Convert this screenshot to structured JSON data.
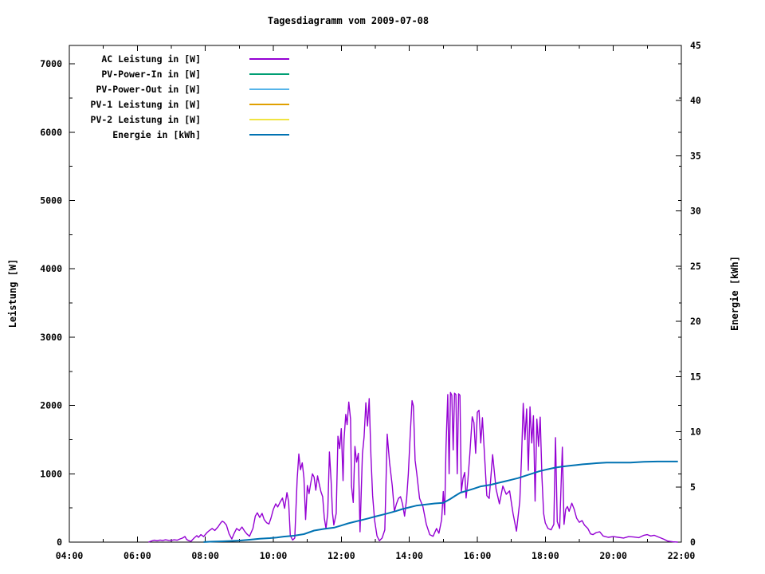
{
  "title": "Tagesdiagramm vom 2009-07-08",
  "chart_data": {
    "type": "line",
    "title": "Tagesdiagramm vom 2009-07-08",
    "grid": false,
    "legend_position": "top-left",
    "x_axis": {
      "range": [
        4,
        22
      ],
      "major_ticks": [
        {
          "h": 4,
          "label": "04:00"
        },
        {
          "h": 6,
          "label": "06:00"
        },
        {
          "h": 8,
          "label": "08:00"
        },
        {
          "h": 10,
          "label": "10:00"
        },
        {
          "h": 12,
          "label": "12:00"
        },
        {
          "h": 14,
          "label": "14:00"
        },
        {
          "h": 16,
          "label": "16:00"
        },
        {
          "h": 18,
          "label": "18:00"
        },
        {
          "h": 20,
          "label": "20:00"
        },
        {
          "h": 22,
          "label": "22:00"
        }
      ],
      "minor_hours": [
        5,
        7,
        9,
        11,
        13,
        15,
        17,
        19,
        21
      ]
    },
    "left_axis": {
      "label": "Leistung [W]",
      "range": [
        0,
        7270
      ],
      "ticks": [
        0,
        1000,
        2000,
        3000,
        4000,
        5000,
        6000,
        7000
      ],
      "minor_step": 500
    },
    "right_axis": {
      "label": "Energie [kWh]",
      "range": [
        0,
        45
      ],
      "ticks": [
        0,
        5,
        10,
        15,
        20,
        25,
        30,
        35,
        40,
        45
      ]
    },
    "series": [
      {
        "name": "AC Leistung in [W]",
        "color": "#9400d3",
        "axis": "left",
        "width": 1.4,
        "points": [
          [
            6.33,
            0
          ],
          [
            6.42,
            18
          ],
          [
            6.5,
            28
          ],
          [
            6.58,
            20
          ],
          [
            6.67,
            30
          ],
          [
            6.75,
            24
          ],
          [
            6.83,
            34
          ],
          [
            6.92,
            26
          ],
          [
            7.0,
            24
          ],
          [
            7.08,
            34
          ],
          [
            7.17,
            28
          ],
          [
            7.25,
            45
          ],
          [
            7.33,
            60
          ],
          [
            7.4,
            82
          ],
          [
            7.45,
            40
          ],
          [
            7.5,
            25
          ],
          [
            7.58,
            12
          ],
          [
            7.67,
            60
          ],
          [
            7.75,
            95
          ],
          [
            7.8,
            70
          ],
          [
            7.87,
            110
          ],
          [
            7.95,
            80
          ],
          [
            8.05,
            140
          ],
          [
            8.12,
            170
          ],
          [
            8.2,
            200
          ],
          [
            8.28,
            170
          ],
          [
            8.37,
            222
          ],
          [
            8.45,
            280
          ],
          [
            8.5,
            307
          ],
          [
            8.55,
            290
          ],
          [
            8.62,
            250
          ],
          [
            8.7,
            120
          ],
          [
            8.78,
            47
          ],
          [
            8.85,
            130
          ],
          [
            8.92,
            200
          ],
          [
            9.0,
            170
          ],
          [
            9.08,
            220
          ],
          [
            9.15,
            165
          ],
          [
            9.22,
            120
          ],
          [
            9.3,
            85
          ],
          [
            9.4,
            200
          ],
          [
            9.47,
            380
          ],
          [
            9.53,
            430
          ],
          [
            9.6,
            360
          ],
          [
            9.67,
            420
          ],
          [
            9.73,
            330
          ],
          [
            9.8,
            285
          ],
          [
            9.87,
            265
          ],
          [
            9.93,
            350
          ],
          [
            10.0,
            480
          ],
          [
            10.07,
            560
          ],
          [
            10.13,
            515
          ],
          [
            10.2,
            585
          ],
          [
            10.27,
            645
          ],
          [
            10.33,
            495
          ],
          [
            10.4,
            725
          ],
          [
            10.45,
            590
          ],
          [
            10.5,
            95
          ],
          [
            10.57,
            30
          ],
          [
            10.63,
            60
          ],
          [
            10.7,
            920
          ],
          [
            10.75,
            1290
          ],
          [
            10.8,
            1060
          ],
          [
            10.85,
            1160
          ],
          [
            10.9,
            940
          ],
          [
            10.95,
            330
          ],
          [
            11.0,
            830
          ],
          [
            11.05,
            710
          ],
          [
            11.1,
            860
          ],
          [
            11.15,
            1000
          ],
          [
            11.2,
            950
          ],
          [
            11.25,
            760
          ],
          [
            11.3,
            970
          ],
          [
            11.35,
            850
          ],
          [
            11.4,
            740
          ],
          [
            11.45,
            665
          ],
          [
            11.5,
            350
          ],
          [
            11.55,
            200
          ],
          [
            11.6,
            430
          ],
          [
            11.65,
            1320
          ],
          [
            11.7,
            900
          ],
          [
            11.74,
            430
          ],
          [
            11.78,
            250
          ],
          [
            11.85,
            420
          ],
          [
            11.9,
            1550
          ],
          [
            11.95,
            1370
          ],
          [
            12.0,
            1660
          ],
          [
            12.05,
            900
          ],
          [
            12.08,
            1500
          ],
          [
            12.13,
            1870
          ],
          [
            12.17,
            1720
          ],
          [
            12.22,
            2050
          ],
          [
            12.27,
            1800
          ],
          [
            12.3,
            820
          ],
          [
            12.35,
            580
          ],
          [
            12.4,
            1400
          ],
          [
            12.45,
            1170
          ],
          [
            12.5,
            1300
          ],
          [
            12.55,
            150
          ],
          [
            12.62,
            1290
          ],
          [
            12.67,
            1540
          ],
          [
            12.72,
            2040
          ],
          [
            12.77,
            1700
          ],
          [
            12.82,
            2100
          ],
          [
            12.87,
            1260
          ],
          [
            12.92,
            680
          ],
          [
            12.98,
            320
          ],
          [
            13.05,
            90
          ],
          [
            13.12,
            20
          ],
          [
            13.2,
            60
          ],
          [
            13.28,
            180
          ],
          [
            13.35,
            1580
          ],
          [
            13.42,
            1160
          ],
          [
            13.5,
            820
          ],
          [
            13.56,
            450
          ],
          [
            13.62,
            560
          ],
          [
            13.68,
            640
          ],
          [
            13.74,
            665
          ],
          [
            13.8,
            560
          ],
          [
            13.86,
            380
          ],
          [
            13.92,
            640
          ],
          [
            13.97,
            995
          ],
          [
            14.03,
            1600
          ],
          [
            14.08,
            2070
          ],
          [
            14.12,
            1990
          ],
          [
            14.17,
            1200
          ],
          [
            14.22,
            995
          ],
          [
            14.3,
            640
          ],
          [
            14.4,
            520
          ],
          [
            14.5,
            260
          ],
          [
            14.6,
            110
          ],
          [
            14.7,
            85
          ],
          [
            14.8,
            200
          ],
          [
            14.87,
            130
          ],
          [
            14.95,
            330
          ],
          [
            15.0,
            740
          ],
          [
            15.04,
            400
          ],
          [
            15.08,
            1400
          ],
          [
            15.13,
            2160
          ],
          [
            15.17,
            1000
          ],
          [
            15.21,
            2190
          ],
          [
            15.25,
            2150
          ],
          [
            15.29,
            1350
          ],
          [
            15.33,
            2180
          ],
          [
            15.37,
            2160
          ],
          [
            15.41,
            1000
          ],
          [
            15.45,
            2170
          ],
          [
            15.49,
            2150
          ],
          [
            15.53,
            740
          ],
          [
            15.58,
            935
          ],
          [
            15.63,
            1020
          ],
          [
            15.67,
            645
          ],
          [
            15.72,
            900
          ],
          [
            15.78,
            1290
          ],
          [
            15.85,
            1835
          ],
          [
            15.9,
            1750
          ],
          [
            15.95,
            1300
          ],
          [
            16.0,
            1900
          ],
          [
            16.05,
            1930
          ],
          [
            16.1,
            1450
          ],
          [
            16.15,
            1820
          ],
          [
            16.2,
            1380
          ],
          [
            16.28,
            680
          ],
          [
            16.35,
            640
          ],
          [
            16.45,
            1280
          ],
          [
            16.55,
            780
          ],
          [
            16.65,
            560
          ],
          [
            16.75,
            820
          ],
          [
            16.85,
            700
          ],
          [
            16.95,
            750
          ],
          [
            17.05,
            420
          ],
          [
            17.15,
            160
          ],
          [
            17.25,
            600
          ],
          [
            17.3,
            1250
          ],
          [
            17.35,
            2030
          ],
          [
            17.4,
            1500
          ],
          [
            17.45,
            1950
          ],
          [
            17.5,
            1050
          ],
          [
            17.55,
            1980
          ],
          [
            17.6,
            1450
          ],
          [
            17.65,
            1850
          ],
          [
            17.7,
            600
          ],
          [
            17.75,
            1800
          ],
          [
            17.8,
            1400
          ],
          [
            17.85,
            1830
          ],
          [
            17.9,
            950
          ],
          [
            17.95,
            420
          ],
          [
            18.0,
            280
          ],
          [
            18.08,
            200
          ],
          [
            18.17,
            180
          ],
          [
            18.25,
            260
          ],
          [
            18.3,
            1530
          ],
          [
            18.35,
            300
          ],
          [
            18.42,
            200
          ],
          [
            18.5,
            1390
          ],
          [
            18.55,
            260
          ],
          [
            18.6,
            480
          ],
          [
            18.65,
            520
          ],
          [
            18.7,
            450
          ],
          [
            18.78,
            570
          ],
          [
            18.85,
            480
          ],
          [
            18.92,
            350
          ],
          [
            19.0,
            290
          ],
          [
            19.08,
            315
          ],
          [
            19.15,
            250
          ],
          [
            19.25,
            200
          ],
          [
            19.33,
            120
          ],
          [
            19.4,
            110
          ],
          [
            19.5,
            140
          ],
          [
            19.6,
            150
          ],
          [
            19.7,
            90
          ],
          [
            19.85,
            70
          ],
          [
            20.0,
            80
          ],
          [
            20.15,
            70
          ],
          [
            20.3,
            60
          ],
          [
            20.45,
            80
          ],
          [
            20.6,
            75
          ],
          [
            20.75,
            65
          ],
          [
            20.9,
            100
          ],
          [
            21.0,
            110
          ],
          [
            21.1,
            90
          ],
          [
            21.2,
            100
          ],
          [
            21.35,
            70
          ],
          [
            21.5,
            40
          ],
          [
            21.6,
            15
          ],
          [
            21.75,
            5
          ],
          [
            21.9,
            0
          ]
        ]
      },
      {
        "name": "PV-Power-In in [W]",
        "color": "#009e73",
        "axis": "left",
        "width": 1.4,
        "points": []
      },
      {
        "name": "PV-Power-Out in [W]",
        "color": "#56b4e9",
        "axis": "left",
        "width": 1.4,
        "points": []
      },
      {
        "name": "PV-1 Leistung in [W]",
        "color": "#e0a000",
        "axis": "left",
        "width": 1.4,
        "points": []
      },
      {
        "name": "PV-2 Leistung in [W]",
        "color": "#f0e442",
        "axis": "left",
        "width": 1.4,
        "points": []
      },
      {
        "name": "Energie in [kWh]",
        "color": "#0072b2",
        "axis": "right",
        "width": 2,
        "points": [
          [
            7.95,
            0.01
          ],
          [
            8.2,
            0.04
          ],
          [
            8.5,
            0.07
          ],
          [
            8.8,
            0.11
          ],
          [
            9.0,
            0.14
          ],
          [
            9.3,
            0.22
          ],
          [
            9.6,
            0.3
          ],
          [
            9.9,
            0.36
          ],
          [
            10.1,
            0.42
          ],
          [
            10.3,
            0.5
          ],
          [
            10.6,
            0.58
          ],
          [
            10.9,
            0.72
          ],
          [
            11.2,
            1.05
          ],
          [
            11.5,
            1.2
          ],
          [
            11.8,
            1.32
          ],
          [
            12.0,
            1.5
          ],
          [
            12.2,
            1.7
          ],
          [
            12.4,
            1.85
          ],
          [
            12.6,
            2.0
          ],
          [
            12.8,
            2.15
          ],
          [
            13.0,
            2.32
          ],
          [
            13.3,
            2.55
          ],
          [
            13.6,
            2.8
          ],
          [
            13.8,
            3.0
          ],
          [
            14.0,
            3.15
          ],
          [
            14.2,
            3.3
          ],
          [
            14.5,
            3.42
          ],
          [
            14.75,
            3.5
          ],
          [
            15.0,
            3.56
          ],
          [
            15.2,
            3.9
          ],
          [
            15.35,
            4.2
          ],
          [
            15.5,
            4.48
          ],
          [
            15.7,
            4.65
          ],
          [
            15.9,
            4.85
          ],
          [
            16.1,
            5.05
          ],
          [
            16.4,
            5.2
          ],
          [
            16.6,
            5.35
          ],
          [
            16.8,
            5.5
          ],
          [
            17.0,
            5.65
          ],
          [
            17.2,
            5.8
          ],
          [
            17.4,
            6.0
          ],
          [
            17.6,
            6.2
          ],
          [
            17.8,
            6.4
          ],
          [
            18.0,
            6.55
          ],
          [
            18.15,
            6.65
          ],
          [
            18.3,
            6.75
          ],
          [
            18.5,
            6.85
          ],
          [
            18.7,
            6.92
          ],
          [
            18.9,
            6.98
          ],
          [
            19.1,
            7.05
          ],
          [
            19.3,
            7.1
          ],
          [
            19.5,
            7.15
          ],
          [
            19.8,
            7.2
          ],
          [
            20.5,
            7.2
          ],
          [
            20.9,
            7.28
          ],
          [
            21.3,
            7.3
          ],
          [
            21.9,
            7.3
          ]
        ]
      }
    ]
  }
}
